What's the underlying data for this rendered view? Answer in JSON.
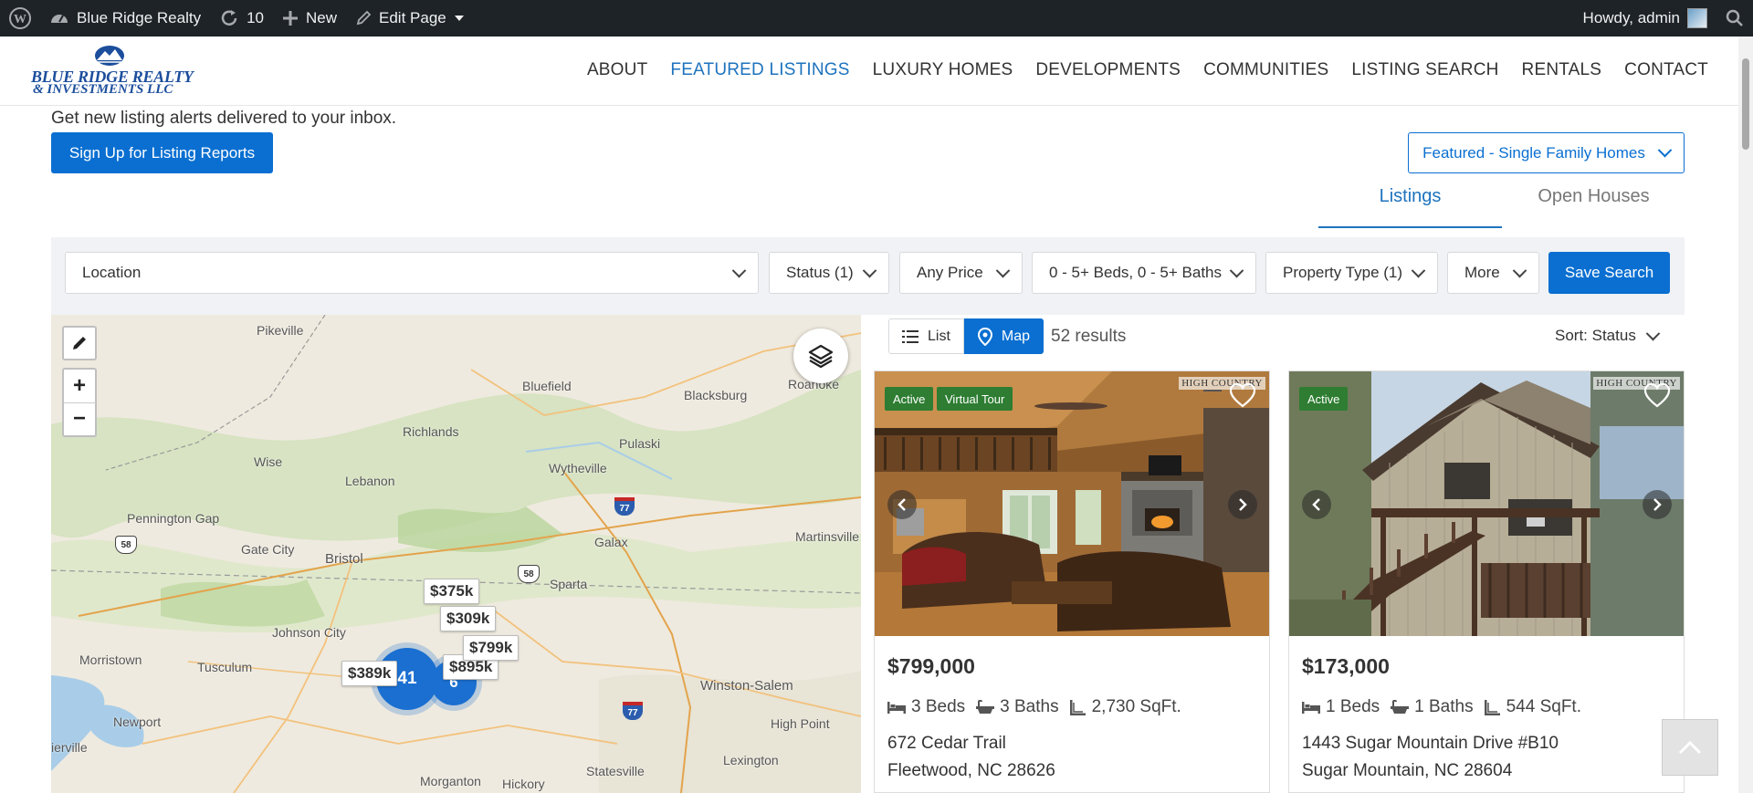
{
  "adminbar": {
    "site_name": "Blue Ridge Realty",
    "updates_count": "10",
    "new_label": "New",
    "edit_label": "Edit Page",
    "howdy": "Howdy, admin"
  },
  "logo": {
    "line1": "BLUE RIDGE REALTY",
    "line2": "& INVESTMENTS LLC"
  },
  "nav": {
    "items": [
      "ABOUT",
      "FEATURED LISTINGS",
      "LUXURY HOMES",
      "DEVELOPMENTS",
      "COMMUNITIES",
      "LISTING SEARCH",
      "RENTALS",
      "CONTACT"
    ],
    "active": "FEATURED LISTINGS"
  },
  "alerts": {
    "text": "Get new listing alerts delivered to your inbox.",
    "button": "Sign Up for Listing Reports"
  },
  "featured_select": {
    "value": "Featured - Single Family Homes"
  },
  "tabs": {
    "listings": "Listings",
    "open_houses": "Open Houses"
  },
  "filters": {
    "location": "Location",
    "status": "Status (1)",
    "price": "Any Price",
    "beds_baths": "0 - 5+ Beds, 0 - 5+ Baths",
    "property_type": "Property Type (1)",
    "more": "More",
    "save_search": "Save Search"
  },
  "map": {
    "labels": {
      "pikeville": "Pikeville",
      "bluefield": "Bluefield",
      "blacksburg": "Blacksburg",
      "roanoke": "Roanoke",
      "richlands": "Richlands",
      "pulaski": "Pulaski",
      "wise": "Wise",
      "lebanon": "Lebanon",
      "wytheville": "Wytheville",
      "pennington_gap": "Pennington Gap",
      "martinsville": "Martinsville",
      "gate_city": "Gate City",
      "bristol": "Bristol",
      "galax": "Galax",
      "sparta": "Sparta",
      "johnson_city": "Johnson City",
      "morristown": "Morristown",
      "tusculum": "Tusculum",
      "winston_salem": "Winston-Salem",
      "newport": "Newport",
      "high_point": "High Point",
      "lexington": "Lexington",
      "statesville": "Statesville",
      "morganton": "Morganton",
      "hickory": "Hickory",
      "sevierville": "ierville"
    },
    "shields": {
      "i77a": "77",
      "i77b": "77",
      "us58a": "58",
      "us58b": "58"
    },
    "markers": {
      "m1": "$375k",
      "m2": "$309k",
      "m3": "$799k",
      "m4": "$389k",
      "m5": "$895k"
    },
    "clusters": {
      "c1": "41",
      "c2": "6"
    }
  },
  "results": {
    "list_label": "List",
    "map_label": "Map",
    "count": "52 results",
    "sort": "Sort: Status"
  },
  "listings": [
    {
      "badges": [
        "Active",
        "Virtual Tour"
      ],
      "watermark": "HIGH COUNTRY",
      "price": "$799,000",
      "beds": "3 Beds",
      "baths": "3 Baths",
      "sqft": "2,730 SqFt.",
      "address": "672 Cedar Trail",
      "city": "Fleetwood, NC 28626"
    },
    {
      "badges": [
        "Active"
      ],
      "watermark": "HIGH COUNTRY",
      "price": "$173,000",
      "beds": "1 Beds",
      "baths": "1 Baths",
      "sqft": "544 SqFt.",
      "address": "1443 Sugar Mountain Drive #B10",
      "city": "Sugar Mountain, NC 28604"
    }
  ],
  "colors": {
    "accent": "#0a6fd1",
    "nav_active": "#1e73be",
    "badge_green": "#2e7d32",
    "adminbar": "#1d2327"
  }
}
